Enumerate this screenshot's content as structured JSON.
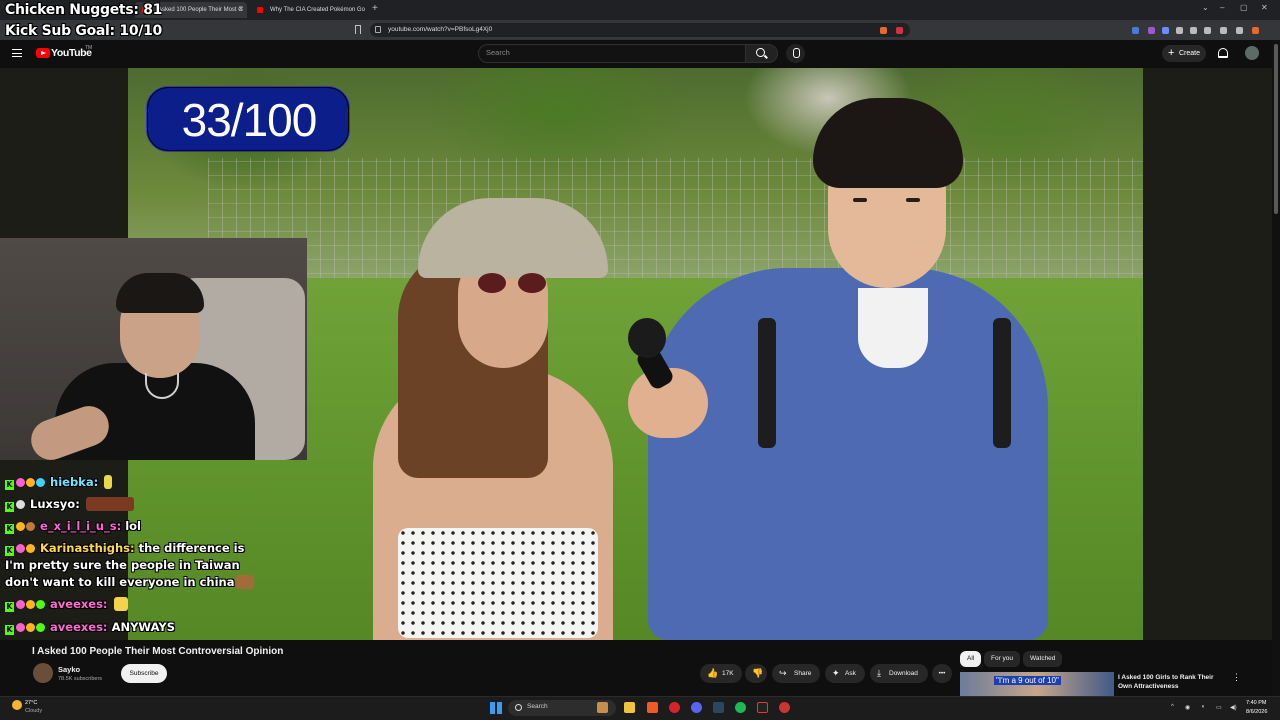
{
  "overlay": {
    "nuggets": "Chicken Nuggets: 81",
    "sub_goal": "Kick Sub Goal: 10/10",
    "counter": "33/100"
  },
  "browser": {
    "tabs": [
      {
        "title": "I Asked 100 People Their Most C",
        "active": true
      },
      {
        "title": "Why The CIA Created Pokémon Go",
        "active": false
      }
    ],
    "url": "youtube.com/watch?v=PBfsoLg4Xj0",
    "window_controls": [
      "⌄",
      "–",
      "▢",
      "✕"
    ]
  },
  "youtube": {
    "logo": "YouTube",
    "tm": "TM",
    "search_placeholder": "Search",
    "create_label": "Create"
  },
  "chat": [
    {
      "user": "hiebka:",
      "text": "",
      "user_color": "#6ee6ff"
    },
    {
      "user": "Luxsyo:",
      "text": "",
      "user_color": "#ffffff"
    },
    {
      "user": "e_x_i_l_i_u_s:",
      "text": "lol",
      "user_color": "#ff63d8"
    },
    {
      "user": "Karinasthighs:",
      "text": "the difference is",
      "user_color": "#ffd84a"
    },
    {
      "user": "",
      "text": "I'm pretty sure the people in Taiwan",
      "user_color": "#ffffff"
    },
    {
      "user": "",
      "text": "don't want to kill everyone in china",
      "user_color": "#ffffff"
    },
    {
      "user": "aveexes:",
      "text": "",
      "user_color": "#ff6ad5"
    },
    {
      "user": "aveexes:",
      "text": "ANYWAYS",
      "user_color": "#ff6ad5"
    }
  ],
  "video": {
    "title": "I Asked 100 People Their Most Controversial Opinion",
    "channel": "Sayko",
    "subscribers": "78.5K subscribers",
    "subscribe_label": "Subscribe",
    "likes": "17K",
    "share_label": "Share",
    "ask_label": "Ask",
    "download_label": "Download",
    "more_label": "•••"
  },
  "filters": {
    "chips": [
      "All",
      "For you",
      "Watched"
    ],
    "active": "All"
  },
  "recommendation": {
    "thumb_text": "\"I'm a 9 out of 10\"",
    "title": "I Asked 100 Girls to Rank Their Own Attractiveness",
    "more": "⋮"
  },
  "taskbar": {
    "temp": "27°C",
    "weather": "Cloudy",
    "search_label": "Search",
    "time": "7:40 PM",
    "date": "8/6/2026"
  },
  "colors": {
    "youtube_red": "#ff0000",
    "counter_badge": "#0b1e8a",
    "kick_green": "#53fc18"
  }
}
